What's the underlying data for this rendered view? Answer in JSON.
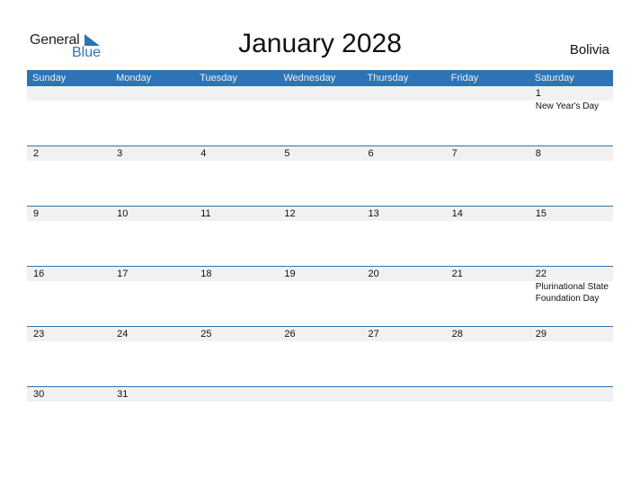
{
  "logo": {
    "word1": "General",
    "word2": "Blue"
  },
  "title": "January 2028",
  "country": "Bolivia",
  "colors": {
    "accent": "#2e74b5",
    "strip": "#f1f1f1"
  },
  "weekdays": [
    "Sunday",
    "Monday",
    "Tuesday",
    "Wednesday",
    "Thursday",
    "Friday",
    "Saturday"
  ],
  "weeks": [
    [
      {
        "day": "",
        "holiday": ""
      },
      {
        "day": "",
        "holiday": ""
      },
      {
        "day": "",
        "holiday": ""
      },
      {
        "day": "",
        "holiday": ""
      },
      {
        "day": "",
        "holiday": ""
      },
      {
        "day": "",
        "holiday": ""
      },
      {
        "day": "1",
        "holiday": "New Year's Day"
      }
    ],
    [
      {
        "day": "2",
        "holiday": ""
      },
      {
        "day": "3",
        "holiday": ""
      },
      {
        "day": "4",
        "holiday": ""
      },
      {
        "day": "5",
        "holiday": ""
      },
      {
        "day": "6",
        "holiday": ""
      },
      {
        "day": "7",
        "holiday": ""
      },
      {
        "day": "8",
        "holiday": ""
      }
    ],
    [
      {
        "day": "9",
        "holiday": ""
      },
      {
        "day": "10",
        "holiday": ""
      },
      {
        "day": "11",
        "holiday": ""
      },
      {
        "day": "12",
        "holiday": ""
      },
      {
        "day": "13",
        "holiday": ""
      },
      {
        "day": "14",
        "holiday": ""
      },
      {
        "day": "15",
        "holiday": ""
      }
    ],
    [
      {
        "day": "16",
        "holiday": ""
      },
      {
        "day": "17",
        "holiday": ""
      },
      {
        "day": "18",
        "holiday": ""
      },
      {
        "day": "19",
        "holiday": ""
      },
      {
        "day": "20",
        "holiday": ""
      },
      {
        "day": "21",
        "holiday": ""
      },
      {
        "day": "22",
        "holiday": "Plurinational State Foundation Day"
      }
    ],
    [
      {
        "day": "23",
        "holiday": ""
      },
      {
        "day": "24",
        "holiday": ""
      },
      {
        "day": "25",
        "holiday": ""
      },
      {
        "day": "26",
        "holiday": ""
      },
      {
        "day": "27",
        "holiday": ""
      },
      {
        "day": "28",
        "holiday": ""
      },
      {
        "day": "29",
        "holiday": ""
      }
    ],
    [
      {
        "day": "30",
        "holiday": ""
      },
      {
        "day": "31",
        "holiday": ""
      },
      {
        "day": "",
        "holiday": ""
      },
      {
        "day": "",
        "holiday": ""
      },
      {
        "day": "",
        "holiday": ""
      },
      {
        "day": "",
        "holiday": ""
      },
      {
        "day": "",
        "holiday": ""
      }
    ]
  ]
}
